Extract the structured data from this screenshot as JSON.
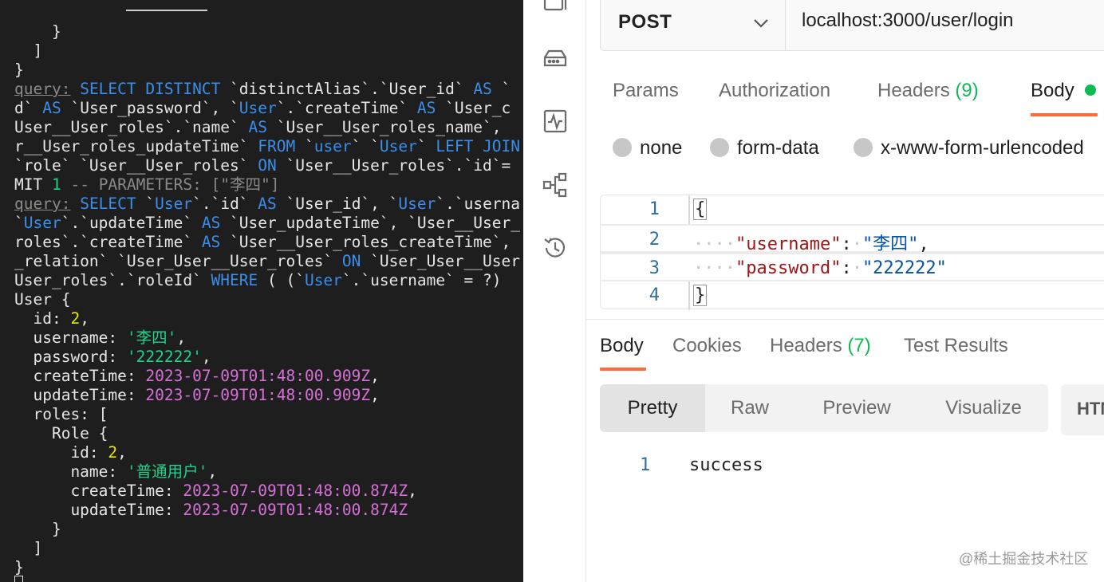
{
  "terminal": {
    "lines": [
      [
        [
          "tx",
          "    }"
        ]
      ],
      [
        [
          "tx",
          "  ]"
        ]
      ],
      [
        [
          "tx",
          "}"
        ]
      ],
      [
        [
          "q",
          "query:"
        ],
        [
          "tx",
          " "
        ],
        [
          "kw",
          "SELECT"
        ],
        [
          "tx",
          " "
        ],
        [
          "kw",
          "DISTINCT"
        ],
        [
          "tx",
          " `distinctAlias`.`User_id` "
        ],
        [
          "kw",
          "AS"
        ],
        [
          "tx",
          " `"
        ]
      ],
      [
        [
          "tx",
          "d` "
        ],
        [
          "kw",
          "AS"
        ],
        [
          "tx",
          " `User_password`, `"
        ],
        [
          "kw",
          "User"
        ],
        [
          "tx",
          "`.`createTime` "
        ],
        [
          "kw",
          "AS"
        ],
        [
          "tx",
          " `User_c"
        ]
      ],
      [
        [
          "tx",
          "User__User_roles`.`name` "
        ],
        [
          "kw",
          "AS"
        ],
        [
          "tx",
          " `User__User_roles_name`,"
        ]
      ],
      [
        [
          "tx",
          "r__User_roles_updateTime` "
        ],
        [
          "kw",
          "FROM"
        ],
        [
          "tx",
          " `"
        ],
        [
          "kw",
          "user"
        ],
        [
          "tx",
          "` `"
        ],
        [
          "kw",
          "User"
        ],
        [
          "tx",
          "` "
        ],
        [
          "kw",
          "LEFT JOIN"
        ]
      ],
      [
        [
          "tx",
          "`role` `User__User_roles` "
        ],
        [
          "kw",
          "ON"
        ],
        [
          "tx",
          " `User__User_roles`.`id`="
        ]
      ],
      [
        [
          "tx",
          "MIT "
        ],
        [
          "str",
          "1"
        ],
        [
          "tx",
          " "
        ],
        [
          "cm",
          "-- PARAMETERS: [\"李四\"]"
        ]
      ],
      [
        [
          "q",
          "query:"
        ],
        [
          "tx",
          " "
        ],
        [
          "kw",
          "SELECT"
        ],
        [
          "tx",
          " `"
        ],
        [
          "kw",
          "User"
        ],
        [
          "tx",
          "`.`id` "
        ],
        [
          "kw",
          "AS"
        ],
        [
          "tx",
          " `User_id`, `"
        ],
        [
          "kw",
          "User"
        ],
        [
          "tx",
          "`.`userna"
        ]
      ],
      [
        [
          "tx",
          "`"
        ],
        [
          "kw",
          "User"
        ],
        [
          "tx",
          "`.`updateTime` "
        ],
        [
          "kw",
          "AS"
        ],
        [
          "tx",
          " `User_updateTime`, `User__User_"
        ]
      ],
      [
        [
          "tx",
          "roles`.`createTime` "
        ],
        [
          "kw",
          "AS"
        ],
        [
          "tx",
          " `User__User_roles_createTime`,"
        ]
      ],
      [
        [
          "tx",
          "_relation` `User_User__User_roles` "
        ],
        [
          "kw",
          "ON"
        ],
        [
          "tx",
          " `User_User__User"
        ]
      ],
      [
        [
          "tx",
          "User_roles`.`roleId` "
        ],
        [
          "kw",
          "WHERE"
        ],
        [
          "tx",
          " ( (`"
        ],
        [
          "kw",
          "User"
        ],
        [
          "tx",
          "`.`username` = ?)"
        ]
      ],
      [
        [
          "tx",
          "User {"
        ]
      ],
      [
        [
          "tx",
          "  id: "
        ],
        [
          "num",
          "2"
        ],
        [
          "tx",
          ","
        ]
      ],
      [
        [
          "tx",
          "  username: "
        ],
        [
          "str",
          "'李四'"
        ],
        [
          "tx",
          ","
        ]
      ],
      [
        [
          "tx",
          "  password: "
        ],
        [
          "str",
          "'222222'"
        ],
        [
          "tx",
          ","
        ]
      ],
      [
        [
          "tx",
          "  createTime: "
        ],
        [
          "dt",
          "2023-07-09T01:48:00.909Z"
        ],
        [
          "tx",
          ","
        ]
      ],
      [
        [
          "tx",
          "  updateTime: "
        ],
        [
          "dt",
          "2023-07-09T01:48:00.909Z"
        ],
        [
          "tx",
          ","
        ]
      ],
      [
        [
          "tx",
          "  roles: ["
        ]
      ],
      [
        [
          "tx",
          "    Role {"
        ]
      ],
      [
        [
          "tx",
          "      id: "
        ],
        [
          "num",
          "2"
        ],
        [
          "tx",
          ","
        ]
      ],
      [
        [
          "tx",
          "      name: "
        ],
        [
          "str",
          "'普通用户'"
        ],
        [
          "tx",
          ","
        ]
      ],
      [
        [
          "tx",
          "      createTime: "
        ],
        [
          "dt",
          "2023-07-09T01:48:00.874Z"
        ],
        [
          "tx",
          ","
        ]
      ],
      [
        [
          "tx",
          "      updateTime: "
        ],
        [
          "dt",
          "2023-07-09T01:48:00.874Z"
        ]
      ],
      [
        [
          "tx",
          "    }"
        ]
      ],
      [
        [
          "tx",
          "  ]"
        ]
      ],
      [
        [
          "tx",
          "}"
        ]
      ]
    ]
  },
  "postman": {
    "sidebar_icons": [
      "collections-icon",
      "environments-icon",
      "monitors-icon",
      "flows-icon",
      "history-icon"
    ],
    "request": {
      "method": "POST",
      "url": "localhost:3000/user/login"
    },
    "request_tabs": {
      "params": "Params",
      "authorization": "Authorization",
      "headers": "Headers",
      "headers_count": "(9)",
      "body": "Body"
    },
    "body_types": {
      "none": "none",
      "form_data": "form-data",
      "urlencoded": "x-www-form-urlencoded"
    },
    "editor": {
      "line_numbers": [
        "1",
        "2",
        "3",
        "4"
      ],
      "open_brace": "{",
      "close_brace": "}",
      "indent": "····",
      "key1": "\"username\"",
      "val1": "\"李四\"",
      "key2": "\"password\"",
      "val2": "\"222222\""
    },
    "response_tabs": {
      "body": "Body",
      "cookies": "Cookies",
      "headers": "Headers",
      "headers_count": "(7)",
      "test_results": "Test Results"
    },
    "view_modes": {
      "pretty": "Pretty",
      "raw": "Raw",
      "preview": "Preview",
      "visualize": "Visualize"
    },
    "format_selected": "HTML",
    "response": {
      "line_number": "1",
      "text": "success"
    }
  },
  "watermark": "@稀土掘金技术社区",
  "colors": {
    "accent": "#ff6c37",
    "success_green": "#0cbb52",
    "terminal_bg": "#1e1e1e",
    "keyword_blue": "#3b8eea",
    "string_green": "#23d18b",
    "date_magenta": "#d670d6",
    "number_yellow": "#e5e510"
  }
}
